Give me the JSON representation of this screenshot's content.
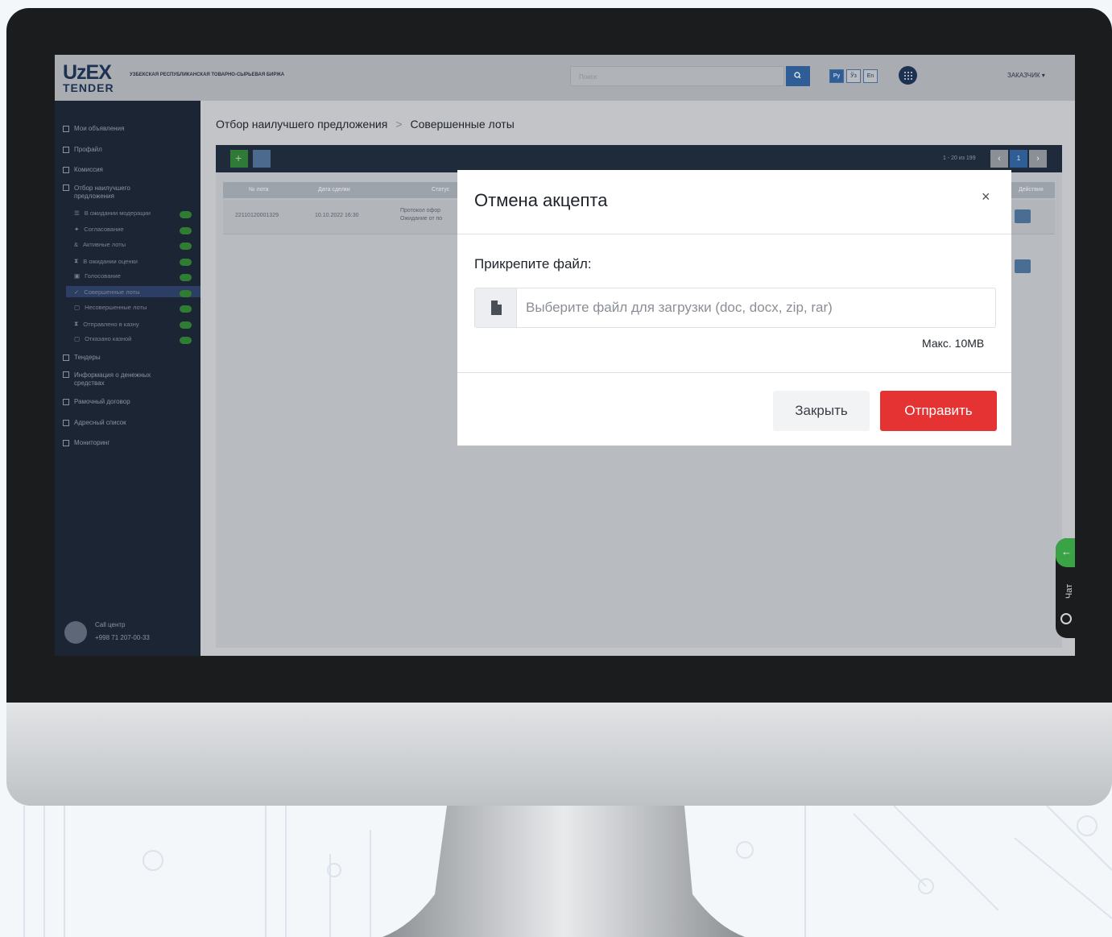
{
  "app": {
    "logo_top": "UzEX",
    "logo_bottom": "TENDER",
    "org_name": "УЗБЕКСКАЯ РЕСПУБЛИКАНСКАЯ ТОВАРНО-СЫРЬЕВАЯ БИРЖА",
    "search_placeholder": "Поиск",
    "languages": [
      "Ру",
      "Ўз",
      "En"
    ],
    "user_role": "ЗАКАЗЧИК"
  },
  "sidebar": {
    "items": [
      {
        "label": "Мои объявления"
      },
      {
        "label": "Профайл"
      },
      {
        "label": "Комиссия"
      },
      {
        "label": "Отбор наилучшего предложения"
      }
    ],
    "subitems": [
      {
        "label": "В ожидании модерации"
      },
      {
        "label": "Согласование"
      },
      {
        "label": "Активные лоты"
      },
      {
        "label": "В ожидании оценки"
      },
      {
        "label": "Голосование"
      },
      {
        "label": "Совершенные лоты"
      },
      {
        "label": "Несовершенные лоты"
      },
      {
        "label": "Отправлено в казну"
      },
      {
        "label": "Отказано казной"
      }
    ],
    "items2": [
      {
        "label": "Тендеры"
      },
      {
        "label": "Информация о денежных средствах"
      },
      {
        "label": "Рамочный договор"
      },
      {
        "label": "Адресный список"
      },
      {
        "label": "Мониторинг"
      }
    ],
    "call_center_label": "Call центр",
    "call_center_phone": "+998 71 207-00-33"
  },
  "breadcrumb": {
    "parent": "Отбор наилучшего предложения",
    "separator": ">",
    "current": "Совершенные лоты"
  },
  "table": {
    "pagination": "1 - 20 из 199",
    "page": "1",
    "headers": [
      "№ лота",
      "Дата сделки",
      "Статус",
      "Действия"
    ],
    "rows": [
      {
        "lot": "22110120001329",
        "date": "10.10.2022 16:30",
        "status_line1": "Протокол офор",
        "status_line2": "Ожидание от по"
      }
    ]
  },
  "modal": {
    "title": "Отмена акцепта",
    "close_symbol": "×",
    "field_label": "Прикрепите файл:",
    "file_placeholder": "Выберите файл для загрузки (doc, docx, zip, rar)",
    "max_size": "Макс. 10MB",
    "close_button": "Закрыть",
    "submit_button": "Отправить"
  },
  "chat": {
    "label": "Чат"
  },
  "colors": {
    "accent": "#e53232",
    "brand": "#1d3152",
    "success": "#2e7d32"
  }
}
